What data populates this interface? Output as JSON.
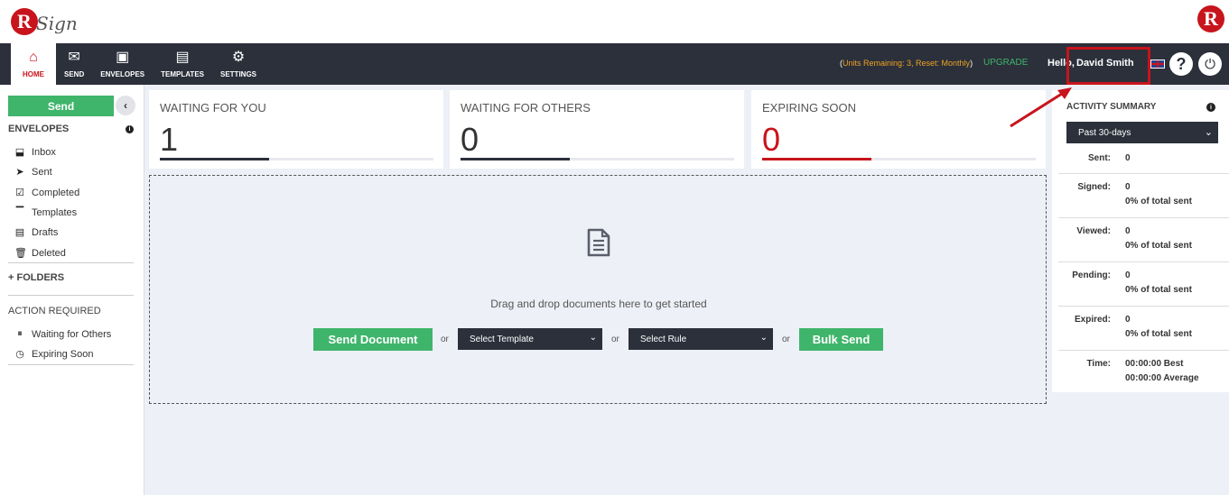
{
  "header": {
    "logo_text": "Sign",
    "logo_letter": "R"
  },
  "nav": {
    "items": [
      {
        "label": "HOME",
        "icon": "home-icon",
        "glyph": "⌂"
      },
      {
        "label": "SEND",
        "icon": "envelope-icon",
        "glyph": "✉"
      },
      {
        "label": "ENVELOPES",
        "icon": "inbox-tray-icon",
        "glyph": "▣"
      },
      {
        "label": "TEMPLATES",
        "icon": "templates-icon",
        "glyph": "▤"
      },
      {
        "label": "SETTINGS",
        "icon": "gear-icon",
        "glyph": "⚙"
      }
    ],
    "units_open": "(",
    "units_text": "Units Remaining: 3, Reset: Monthly",
    "units_close": ")",
    "upgrade": "UPGRADE",
    "hello": "Hello,",
    "user_name": "David Smith"
  },
  "sidebar": {
    "send_label": "Send",
    "collapse_glyph": "‹",
    "envelopes_heading": "ENVELOPES",
    "envelope_items": [
      {
        "label": "Inbox",
        "icon": "inbox-icon",
        "glyph": "⬓"
      },
      {
        "label": "Sent",
        "icon": "paper-plane-icon",
        "glyph": "➤"
      },
      {
        "label": "Completed",
        "icon": "checkbox-icon",
        "glyph": "☑"
      },
      {
        "label": "Templates",
        "icon": "template-icon",
        "glyph": "▔"
      },
      {
        "label": "Drafts",
        "icon": "drafts-icon",
        "glyph": "▤"
      },
      {
        "label": "Deleted",
        "icon": "trash-icon",
        "glyph": "🗑"
      }
    ],
    "folders_heading": "FOLDERS",
    "folders_plus": "+",
    "action_heading": "ACTION REQUIRED",
    "action_items": [
      {
        "label": "Waiting for Others",
        "icon": "pause-circle-icon",
        "glyph": "⏸"
      },
      {
        "label": "Expiring Soon",
        "icon": "clock-icon",
        "glyph": "◷"
      }
    ]
  },
  "cards": [
    {
      "title": "WAITING FOR YOU",
      "value": "1",
      "value_color": "#333333",
      "bar_color": "#2b303b",
      "fill_fraction": 0.4
    },
    {
      "title": "WAITING FOR OTHERS",
      "value": "0",
      "value_color": "#333333",
      "bar_color": "#2b303b",
      "fill_fraction": 0.4
    },
    {
      "title": "EXPIRING SOON",
      "value": "0",
      "value_color": "#c8141c",
      "bar_color": "#c8141c",
      "fill_fraction": 0.4
    }
  ],
  "dropzone": {
    "text": "Drag and drop documents here to get started",
    "send_document": "Send Document",
    "or": "or",
    "select_template": "Select Template",
    "select_rule": "Select Rule",
    "bulk_send": "Bulk Send"
  },
  "activity": {
    "title": "ACTIVITY SUMMARY",
    "range": "Past 30-days",
    "rows": [
      {
        "label": "Sent:",
        "v1": "0",
        "v2": ""
      },
      {
        "label": "Signed:",
        "v1": "0",
        "v2": "0% of total sent"
      },
      {
        "label": "Viewed:",
        "v1": "0",
        "v2": "0% of total sent"
      },
      {
        "label": "Pending:",
        "v1": "0",
        "v2": "0% of total sent"
      },
      {
        "label": "Expired:",
        "v1": "0",
        "v2": "0% of total sent"
      },
      {
        "label": "Time:",
        "v1": "00:00:00 Best",
        "v2": "00:00:00 Average"
      }
    ]
  },
  "colors": {
    "accent_green": "#3fb56b",
    "brand_red": "#c8141c",
    "nav_dark": "#2b303b",
    "units_orange": "#f0a321"
  }
}
